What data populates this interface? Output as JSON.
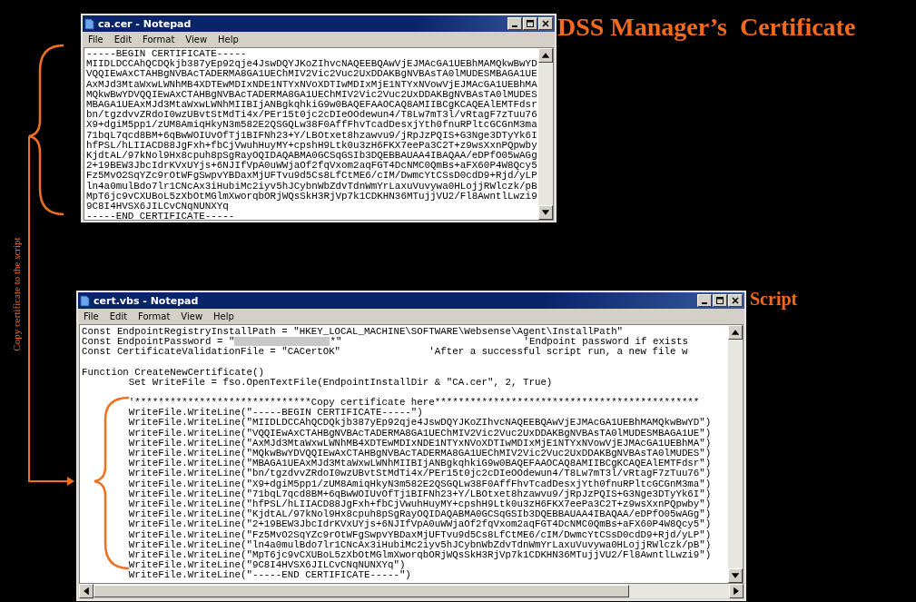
{
  "heading": "DSS Manager’s  Certificate",
  "script_label": "Script",
  "arrow_label": "Copy certificate to the script",
  "certificate_window": {
    "title": "ca.cer - Notepad",
    "menu": [
      "File",
      "Edit",
      "Format",
      "View",
      "Help"
    ],
    "lines": [
      "-----BEGIN CERTIFICATE-----",
      "MIIDLDCCAhQCDQkjb387yEp92qje4JswDQYJKoZIhvcNAQEEBQAwVjEJMAcGA1UEBhMAMQkwBwYD",
      "VQQIEwAxCTAHBgNVBAcTADERMA8GA1UEChMIV2Vic2Vuc2UxDDAKBgNVBAsTA0lMUDESMBAGA1UE",
      "AxMJd3MtaWxwLWNhMB4XDTEwMDIxNDE1NTYxNVoXDTIwMDIxMjE1NTYxNVowVjEJMAcGA1UEBhMA",
      "MQkwBwYDVQQIEwAxCTAHBgNVBAcTADERMA8GA1UEChMIV2Vic2Vuc2UxDDAKBgNVBAsTA0lMUDES",
      "MBAGA1UEAxMJd3MtaWxwLWNhMIIBIjANBgkqhkiG9w0BAQEFAAOCAQ8AMIIBCgKCAQEAlEMTFdsr",
      "bn/tgzdvvZRdoI0wzUBvtStMdTi4x/PEr15t0jc2cDIeOOdewun4/T8Lw7mT3l/vRtagF7zTuu76",
      "X9+dgiM5pp1/zUM8AmiqHkyN3m582E2QSGQLw38F0AffFhvTcadDesxjYth0fnuRPltcGCGnM3ma",
      "71bqL7qcd8BM+6qBwWOIUvOfTj1BIFNh23+Y/LBOtxet8hzawvu9/jRpJzPQIS+G3Nge3DTyYk6I",
      "hfPSL/hLIIACD88JgFxh+fbCjVwuhHuyMY+cpshH9Ltk0u3zH6FKX7eePa3C2T+z9wsXxnPQpwby",
      "KjdtAL/97kNol9Hx8cpuh8pSgRayOQIDAQABMA0GCSqGSIb3DQEBBAUAA4IBAQAA/eDPfO05wAGg",
      "2+19BEW3JbcIdrKVxUYjs+6NJIfVpA0uWWjaOf2fqVxom2aqFGT4DcNMC0QmBs+aFX60P4W8Qcy5",
      "Fz5MvO2SqYZc9rOtWFgSwpvYBDaxMjUFTvu9d5Cs8LfCtME6/cIM/DwmcYtCSsD0cdD9+Rjd/yLP",
      "ln4a0mulBdo7lr1CNcAx3iHubiMc2iyv5hJCybnWbZdvTdnWmYrLaxuVuvywa0HLojjRWlczk/pB",
      "MpT6jc9vCXUBoL5zXbOtMGlmXworqbORjWQsSkH3RjVp7k1CDKHN36MTujjVU2/Fl8AwntlLwzi9",
      "9C8I4HVSX6JILCvCNqNUNXYq",
      "-----END CERTIFICATE-----"
    ]
  },
  "script_window": {
    "title": "cert.vbs - Notepad",
    "menu": [
      "File",
      "Edit",
      "Format",
      "View",
      "Help"
    ],
    "code_lines": [
      {
        "kind": "code",
        "text": "Const EndpointRegistryInstallPath = \"HKEY_LOCAL_MACHINE\\SOFTWARE\\Websense\\Agent\\InstallPath\""
      },
      {
        "kind": "redacted",
        "before": "Const EndpointPassword = \"",
        "after": "*\"",
        "comment": "'Endpoint password if exists"
      },
      {
        "kind": "code",
        "text": "Const CertificateValidationFile = \"CACertOK\"               'After a successful script run, a new file w"
      },
      {
        "kind": "blank"
      },
      {
        "kind": "code",
        "text": "Function CreateNewCertificate()"
      },
      {
        "kind": "code",
        "text": "        Set WriteFile = fso.OpenTextFile(EndpointInstallDir & \"CA.cer\", 2, True)"
      },
      {
        "kind": "blank"
      },
      {
        "kind": "code",
        "text": "        '******************************Copy certificate here*********************************************"
      },
      {
        "kind": "code",
        "text": "        WriteFile.WriteLine(\"-----BEGIN CERTIFICATE-----\")"
      },
      {
        "kind": "code",
        "text": "        WriteFile.WriteLine(\"MIIDLDCCAhQCDQkjb387yEp92qje4JswDQYJKoZIhvcNAQEEBQAwVjEJMAcGA1UEBhMAMQkwBwYD\")"
      },
      {
        "kind": "code",
        "text": "        WriteFile.WriteLine(\"VQQIEwAxCTAHBgNVBAcTADERMA8GA1UEChMIV2Vic2Vuc2UxDDAKBgNVBAsTA0lMUDESMBAGA1UE\")"
      },
      {
        "kind": "code",
        "text": "        WriteFile.WriteLine(\"AxMJd3MtaWxwLWNhMB4XDTEwMDIxNDE1NTYxNVoXDTIwMDIxMjE1NTYxNVowVjEJMAcGA1UEBhMA\")"
      },
      {
        "kind": "code",
        "text": "        WriteFile.WriteLine(\"MQkwBwYDVQQIEwAxCTAHBgNVBAcTADERMA8GA1UEChMIV2Vic2Vuc2UxDDAKBgNVBAsTA0lMUDES\")"
      },
      {
        "kind": "code",
        "text": "        WriteFile.WriteLine(\"MBAGA1UEAxMJd3MtaWxwLWNhMIIBIjANBgkqhkiG9w0BAQEFAAOCAQ8AMIIBCgKCAQEAlEMTFdsr\")"
      },
      {
        "kind": "code",
        "text": "        WriteFile.WriteLine(\"bn/tgzdvvZRdoI0wzUBvtStMdTi4x/PEr15t0jc2cDIeOOdewun4/T8Lw7mT3l/vRtagF7zTuu76\")"
      },
      {
        "kind": "code",
        "text": "        WriteFile.WriteLine(\"X9+dgiM5pp1/zUM8AmiqHkyN3m582E2QSGQLw38F0AffFhvTcadDesxjYth0fnuRPltcGCGnM3ma\")"
      },
      {
        "kind": "code",
        "text": "        WriteFile.WriteLine(\"71bqL7qcd8BM+6qBwWOIUvOfTj1BIFNh23+Y/LBOtxet8hzawvu9/jRpJzPQIS+G3Nge3DTyYk6I\")"
      },
      {
        "kind": "code",
        "text": "        WriteFile.WriteLine(\"hfPSL/hLIIACD88JgFxh+fbCjVwuhHuyMY+cpshH9Ltk0u3zH6FKX7eePa3C2T+z9wsXxnPQpwby\")"
      },
      {
        "kind": "code",
        "text": "        WriteFile.WriteLine(\"KjdtAL/97kNol9Hx8cpuh8pSgRayOQIDAQABMA0GCSqGSIb3DQEBBAUAA4IBAQAA/eDPfO05wAGg\")"
      },
      {
        "kind": "code",
        "text": "        WriteFile.WriteLine(\"2+19BEW3JbcIdrKVxUYjs+6NJIfVpA0uWWjaOf2fqVxom2aqFGT4DcNMC0QmBs+aFX60P4W8Qcy5\")"
      },
      {
        "kind": "code",
        "text": "        WriteFile.WriteLine(\"Fz5MvO2SqYZc9rOtWFgSwpvYBDaxMjUFTvu9d5Cs8LfCtME6/cIM/DwmcYtCSsD0cdD9+Rjd/yLP\")"
      },
      {
        "kind": "code",
        "text": "        WriteFile.WriteLine(\"ln4a0mulBdo7lr1CNcAx3iHubiMc2iyv5hJCybnWbZdvTdnWmYrLaxuVuvywa0HLojjRWlczk/pB\")"
      },
      {
        "kind": "code",
        "text": "        WriteFile.WriteLine(\"MpT6jc9vCXUBoL5zXbOtMGlmXworqbORjWQsSkH3RjVp7k1CDKHN36MTujjVU2/Fl8AwntlLwzi9\")"
      },
      {
        "kind": "code",
        "text": "        WriteFile.WriteLine(\"9C8I4HVSX6JILCvCNqNUNXYq\")"
      },
      {
        "kind": "code",
        "text": "        WriteFile.WriteLine(\"-----END CERTIFICATE-----\")"
      }
    ]
  }
}
